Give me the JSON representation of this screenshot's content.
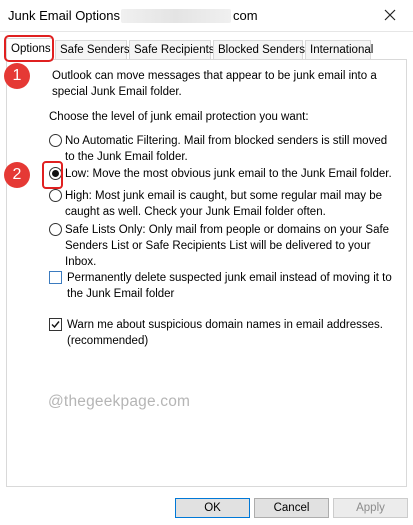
{
  "window": {
    "title": "Junk Email Options -",
    "title_suffix": "com",
    "close_icon": "close-icon"
  },
  "tabs": [
    {
      "label": "Options",
      "active": true
    },
    {
      "label": "Safe Senders",
      "active": false
    },
    {
      "label": "Safe Recipients",
      "active": false
    },
    {
      "label": "Blocked Senders",
      "active": false
    },
    {
      "label": "International",
      "active": false
    }
  ],
  "options": {
    "intro": "Outlook can move messages that appear to be junk email into a special Junk Email folder.",
    "level_prompt": "Choose the level of junk email protection you want:",
    "levels": [
      {
        "label": "No Automatic Filtering. Mail from blocked senders is still moved to the Junk Email folder.",
        "checked": false
      },
      {
        "label": "Low: Move the most obvious junk email to the Junk Email folder.",
        "checked": true
      },
      {
        "label": "High: Most junk email is caught, but some regular mail may be caught as well. Check your Junk Email folder often.",
        "checked": false
      },
      {
        "label": "Safe Lists Only: Only mail from people or domains on your Safe Senders List or Safe Recipients List will be delivered to your Inbox.",
        "checked": false
      }
    ],
    "permanent_delete": {
      "label": "Permanently delete suspected junk email instead of moving it to the Junk Email folder",
      "checked": false
    },
    "warn_domains": {
      "label": "Warn me about suspicious domain names in email addresses. (recommended)",
      "checked": true
    }
  },
  "annotations": {
    "step1": "1",
    "step2": "2",
    "color": "#e53935"
  },
  "watermark": "@thegeekpage.com",
  "buttons": {
    "ok": "OK",
    "cancel": "Cancel",
    "apply": "Apply"
  }
}
